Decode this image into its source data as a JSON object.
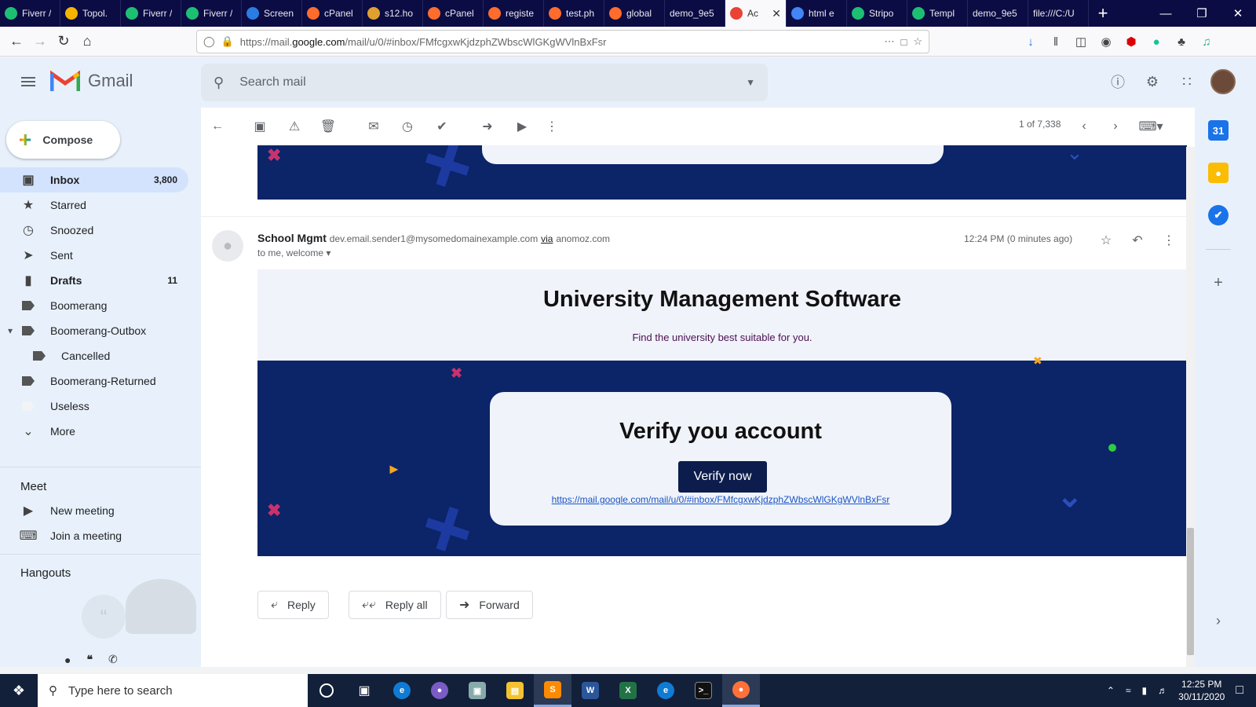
{
  "browser": {
    "tabs": [
      {
        "label": "Fiverr /",
        "fav": "fiverr-icon",
        "color": "#1dbf73"
      },
      {
        "label": "Topol.",
        "fav": "topol-icon",
        "color": "#f4b400"
      },
      {
        "label": "Fiverr /",
        "fav": "fiverr-icon",
        "color": "#1dbf73"
      },
      {
        "label": "Fiverr /",
        "fav": "fiverr-icon",
        "color": "#1dbf73"
      },
      {
        "label": "Screen",
        "fav": "screen-icon",
        "color": "#2a7de1"
      },
      {
        "label": "cPanel",
        "fav": "cpanel-icon",
        "color": "#ff6c2c"
      },
      {
        "label": "s12.ho",
        "fav": "host-icon",
        "color": "#e0a030"
      },
      {
        "label": "cPanel",
        "fav": "cpanel-icon",
        "color": "#ff6c2c"
      },
      {
        "label": "registe",
        "fav": "cpanel-icon",
        "color": "#ff6c2c"
      },
      {
        "label": "test.ph",
        "fav": "cpanel-icon",
        "color": "#ff6c2c"
      },
      {
        "label": "global",
        "fav": "cpanel-icon",
        "color": "#ff6c2c"
      },
      {
        "label": "demo_9e5",
        "fav": "",
        "color": ""
      },
      {
        "label": "Ac",
        "fav": "gmail-icon",
        "color": "#ea4335",
        "active": true
      },
      {
        "label": "html e",
        "fav": "google-icon",
        "color": "#4285f4"
      },
      {
        "label": "Stripo",
        "fav": "stripo-icon",
        "color": "#1dbf73"
      },
      {
        "label": "Templ",
        "fav": "stripo-icon",
        "color": "#1dbf73"
      },
      {
        "label": "demo_9e5",
        "fav": "",
        "color": ""
      },
      {
        "label": "file:///C:/U",
        "fav": "",
        "color": ""
      }
    ],
    "new_tab": "+",
    "url_prefix": "https://mail.",
    "url_host": "google.com",
    "url_rest": "/mail/u/0/#inbox/FMfcgxwKjdzphZWbscWlGKgWVlnBxFsr"
  },
  "gmail": {
    "app_name": "Gmail",
    "search_placeholder": "Search mail",
    "compose_label": "Compose",
    "nav": [
      {
        "label": "Inbox",
        "count": "3,800",
        "icon": "inbox-icon"
      },
      {
        "label": "Starred",
        "count": "",
        "icon": "star-icon"
      },
      {
        "label": "Snoozed",
        "count": "",
        "icon": "clock-icon"
      },
      {
        "label": "Sent",
        "count": "",
        "icon": "send-icon"
      },
      {
        "label": "Drafts",
        "count": "11",
        "icon": "draft-icon"
      },
      {
        "label": "Boomerang",
        "count": "",
        "icon": "label-icon"
      },
      {
        "label": "Boomerang-Outbox",
        "count": "",
        "icon": "label-icon"
      },
      {
        "label": "Cancelled",
        "count": "",
        "icon": "label-icon"
      },
      {
        "label": "Boomerang-Returned",
        "count": "",
        "icon": "label-icon"
      },
      {
        "label": "Useless",
        "count": "",
        "icon": "label-icon"
      },
      {
        "label": "More",
        "count": "",
        "icon": "chevron-down-icon"
      }
    ],
    "meet_heading": "Meet",
    "meet_items": [
      "New meeting",
      "Join a meeting"
    ],
    "hangouts_heading": "Hangouts",
    "pagination": "1 of 7,338"
  },
  "message": {
    "sender_name": "School Mgmt",
    "sender_email": "dev.email.sender1@mysomedomainexample.com",
    "via_label": "via",
    "via_domain": "anomoz.com",
    "recipients": "to me, welcome",
    "time": "12:24 PM (0 minutes ago)",
    "email_title": "University Management Software",
    "email_subtitle": "Find the university best suitable for you.",
    "verify_title": "Verify you account",
    "verify_button": "Verify now",
    "verify_link": "https://mail.google.com/mail/u/0/#inbox/FMfcgxwKjdzphZWbscWlGKgWVlnBxFsr",
    "reply_label": "Reply",
    "reply_all_label": "Reply all",
    "forward_label": "Forward"
  },
  "taskbar": {
    "search_placeholder": "Type here to search",
    "time": "12:25 PM",
    "date": "30/11/2020"
  },
  "colors": {
    "banner": "#0c2468",
    "gmail_bg": "#e8f1fb",
    "verify_button": "#0c1d4d"
  }
}
